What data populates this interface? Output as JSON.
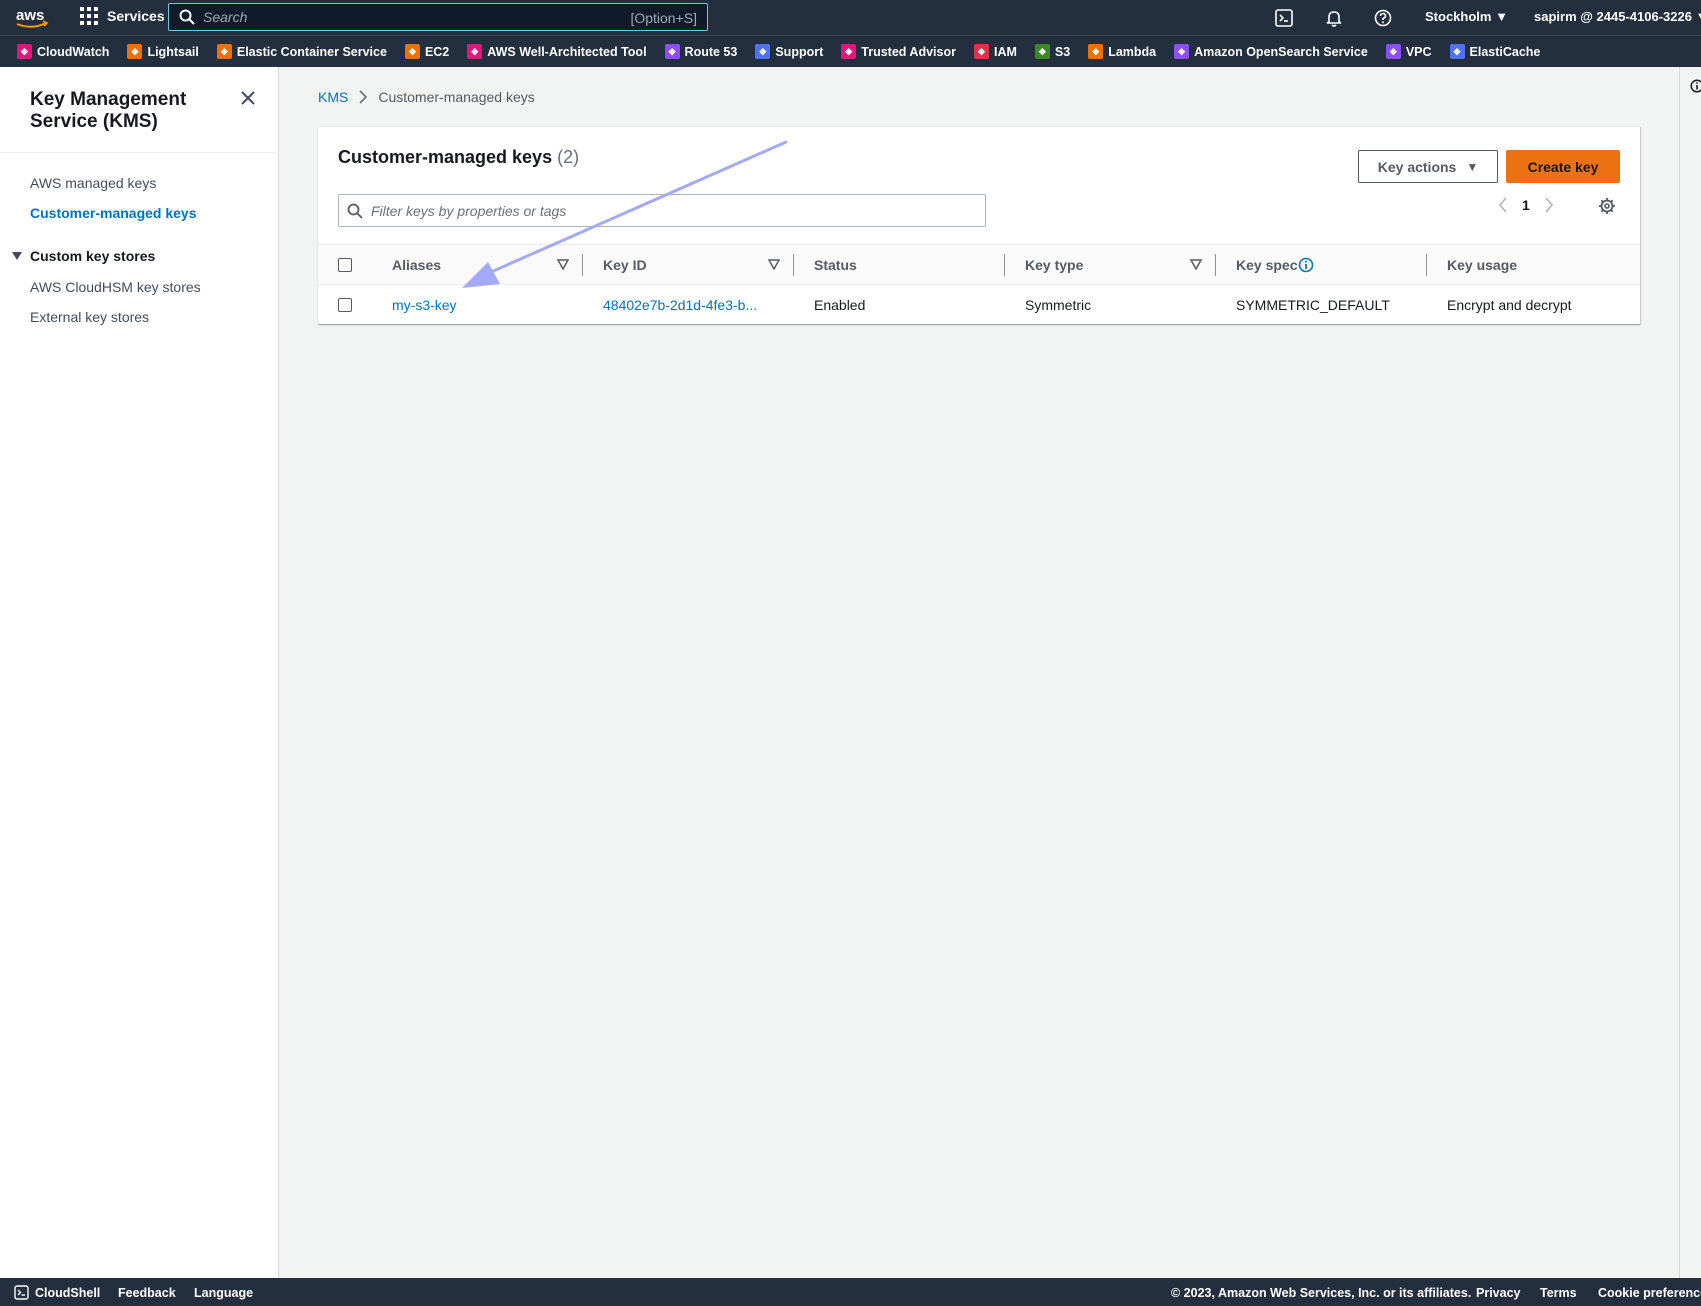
{
  "topnav": {
    "services_label": "Services",
    "search_placeholder": "Search",
    "search_shortcut": "[Option+S]",
    "region": "Stockholm",
    "account": "sapirm @ 2445-4106-3226"
  },
  "favorites": [
    {
      "label": "CloudWatch",
      "color": "#e7157b"
    },
    {
      "label": "Lightsail",
      "color": "#ed7100"
    },
    {
      "label": "Elastic Container Service",
      "color": "#ed7100"
    },
    {
      "label": "EC2",
      "color": "#ed7100"
    },
    {
      "label": "AWS Well-Architected Tool",
      "color": "#e7157b"
    },
    {
      "label": "Route 53",
      "color": "#8c4fff"
    },
    {
      "label": "Support",
      "color": "#4d72f3"
    },
    {
      "label": "Trusted Advisor",
      "color": "#e7157b"
    },
    {
      "label": "IAM",
      "color": "#dd344c"
    },
    {
      "label": "S3",
      "color": "#3f8624"
    },
    {
      "label": "Lambda",
      "color": "#ed7100"
    },
    {
      "label": "Amazon OpenSearch Service",
      "color": "#8c4fff"
    },
    {
      "label": "VPC",
      "color": "#8c4fff"
    },
    {
      "label": "ElastiCache",
      "color": "#4d72f3"
    }
  ],
  "sidebar": {
    "title": "Key Management Service (KMS)",
    "items": [
      {
        "label": "AWS managed keys"
      },
      {
        "label": "Customer-managed keys"
      }
    ],
    "section": {
      "label": "Custom key stores",
      "items": [
        {
          "label": "AWS CloudHSM key stores"
        },
        {
          "label": "External key stores"
        }
      ]
    }
  },
  "breadcrumb": {
    "root": "KMS",
    "current": "Customer-managed keys"
  },
  "panel": {
    "title": "Customer-managed keys",
    "count": "(2)",
    "key_actions_label": "Key actions",
    "create_key_label": "Create key",
    "filter_placeholder": "Filter keys by properties or tags",
    "page_number": "1"
  },
  "table": {
    "columns": [
      "Aliases",
      "Key ID",
      "Status",
      "Key type",
      "Key spec",
      "Key usage"
    ],
    "rows": [
      {
        "alias": "my-s3-key",
        "key_id": "48402e7b-2d1d-4fe3-b...",
        "status": "Enabled",
        "key_type": "Symmetric",
        "key_spec": "SYMMETRIC_DEFAULT",
        "key_usage": "Encrypt and decrypt"
      }
    ]
  },
  "footer": {
    "cloudshell": "CloudShell",
    "feedback": "Feedback",
    "language": "Language",
    "copyright": "© 2023, Amazon Web Services, Inc. or its affiliates.",
    "privacy": "Privacy",
    "terms": "Terms",
    "cookies": "Cookie preferences"
  },
  "colors": {
    "nav_bg": "#232f3e",
    "link": "#0073bb",
    "primary_button": "#ec7211",
    "annotation_arrow": "#a4a9fb"
  }
}
